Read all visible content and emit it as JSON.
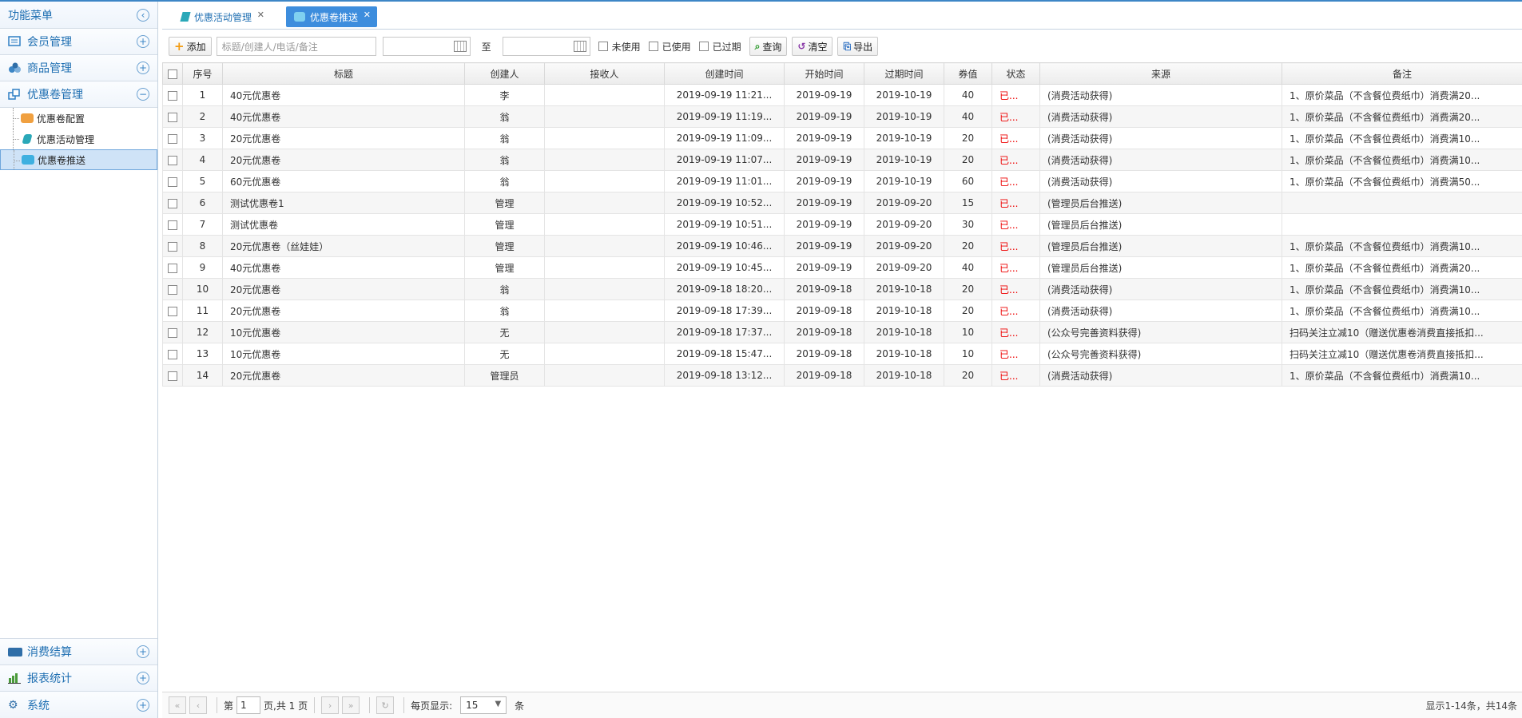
{
  "sidebar": {
    "header": "功能菜单",
    "groups": [
      {
        "label": "会员管理",
        "icon": "member-icon"
      },
      {
        "label": "商品管理",
        "icon": "goods-icon"
      },
      {
        "label": "优惠卷管理",
        "icon": "coupon-icon"
      }
    ],
    "subitems": [
      {
        "label": "优惠卷配置"
      },
      {
        "label": "优惠活动管理"
      },
      {
        "label": "优惠卷推送"
      }
    ],
    "bottom_groups": [
      {
        "label": "消费结算",
        "icon": "paypal-icon"
      },
      {
        "label": "报表统计",
        "icon": "chart-icon"
      },
      {
        "label": "系统",
        "icon": "gear-icon"
      }
    ]
  },
  "tabs": [
    {
      "label": "优惠活动管理"
    },
    {
      "label": "优惠卷推送"
    }
  ],
  "toolbar": {
    "add": "添加",
    "search_placeholder": "标题/创建人/电话/备注",
    "to": "至",
    "unused": "未使用",
    "used": "已使用",
    "expired": "已过期",
    "query": "查询",
    "clear": "清空",
    "export": "导出"
  },
  "table": {
    "columns": [
      "序号",
      "标题",
      "创建人",
      "接收人",
      "创建时间",
      "开始时间",
      "过期时间",
      "券值",
      "状态",
      "来源",
      "备注"
    ],
    "rows": [
      [
        "1",
        "40元优惠卷",
        "李",
        "",
        "2019-09-19 11:21...",
        "2019-09-19",
        "2019-10-19",
        "40",
        "已...",
        "(消费活动获得)",
        "1、原价菜品（不含餐位费纸巾）消费满20..."
      ],
      [
        "2",
        "40元优惠卷",
        "翁",
        "",
        "2019-09-19 11:19...",
        "2019-09-19",
        "2019-10-19",
        "40",
        "已...",
        "(消费活动获得)",
        "1、原价菜品（不含餐位费纸巾）消费满20..."
      ],
      [
        "3",
        "20元优惠卷",
        "翁",
        "",
        "2019-09-19 11:09...",
        "2019-09-19",
        "2019-10-19",
        "20",
        "已...",
        "(消费活动获得)",
        "1、原价菜品（不含餐位费纸巾）消费满10..."
      ],
      [
        "4",
        "20元优惠卷",
        "翁",
        "",
        "2019-09-19 11:07...",
        "2019-09-19",
        "2019-10-19",
        "20",
        "已...",
        "(消费活动获得)",
        "1、原价菜品（不含餐位费纸巾）消费满10..."
      ],
      [
        "5",
        "60元优惠卷",
        "翁",
        "",
        "2019-09-19 11:01...",
        "2019-09-19",
        "2019-10-19",
        "60",
        "已...",
        "(消费活动获得)",
        "1、原价菜品（不含餐位费纸巾）消费满50..."
      ],
      [
        "6",
        "测试优惠卷1",
        "管理",
        "",
        "2019-09-19 10:52...",
        "2019-09-19",
        "2019-09-20",
        "15",
        "已...",
        "(管理员后台推送)",
        ""
      ],
      [
        "7",
        "测试优惠卷",
        "管理",
        "",
        "2019-09-19 10:51...",
        "2019-09-19",
        "2019-09-20",
        "30",
        "已...",
        "(管理员后台推送)",
        ""
      ],
      [
        "8",
        "20元优惠卷（丝娃娃）",
        "管理",
        "",
        "2019-09-19 10:46...",
        "2019-09-19",
        "2019-09-20",
        "20",
        "已...",
        "(管理员后台推送)",
        "1、原价菜品（不含餐位费纸巾）消费满10..."
      ],
      [
        "9",
        "40元优惠卷",
        "管理",
        "",
        "2019-09-19 10:45...",
        "2019-09-19",
        "2019-09-20",
        "40",
        "已...",
        "(管理员后台推送)",
        "1、原价菜品（不含餐位费纸巾）消费满20..."
      ],
      [
        "10",
        "20元优惠卷",
        "翁",
        "",
        "2019-09-18 18:20...",
        "2019-09-18",
        "2019-10-18",
        "20",
        "已...",
        "(消费活动获得)",
        "1、原价菜品（不含餐位费纸巾）消费满10..."
      ],
      [
        "11",
        "20元优惠卷",
        "翁",
        "",
        "2019-09-18 17:39...",
        "2019-09-18",
        "2019-10-18",
        "20",
        "已...",
        "(消费活动获得)",
        "1、原价菜品（不含餐位费纸巾）消费满10..."
      ],
      [
        "12",
        "10元优惠卷",
        "无",
        "",
        "2019-09-18 17:37...",
        "2019-09-18",
        "2019-10-18",
        "10",
        "已...",
        "(公众号完善资料获得)",
        "扫码关注立减10（赠送优惠卷消费直接抵扣..."
      ],
      [
        "13",
        "10元优惠卷",
        "无",
        "",
        "2019-09-18 15:47...",
        "2019-09-18",
        "2019-10-18",
        "10",
        "已...",
        "(公众号完善资料获得)",
        "扫码关注立减10（赠送优惠卷消费直接抵扣..."
      ],
      [
        "14",
        "20元优惠卷",
        "管理员",
        "",
        "2019-09-18 13:12...",
        "2019-09-18",
        "2019-10-18",
        "20",
        "已...",
        "(消费活动获得)",
        "1、原价菜品（不含餐位费纸巾）消费满10..."
      ]
    ]
  },
  "pager": {
    "page_prefix": "第",
    "page_value": "1",
    "page_suffix": "页,共 1 页",
    "per_page_label": "每页显示:",
    "per_page_value": "15",
    "per_page_unit": "条",
    "info": "显示1-14条，共14条"
  },
  "colors": {
    "accent": "#3d86c6",
    "status_red": "#e00000",
    "tab_active": "#3d8ddd"
  }
}
